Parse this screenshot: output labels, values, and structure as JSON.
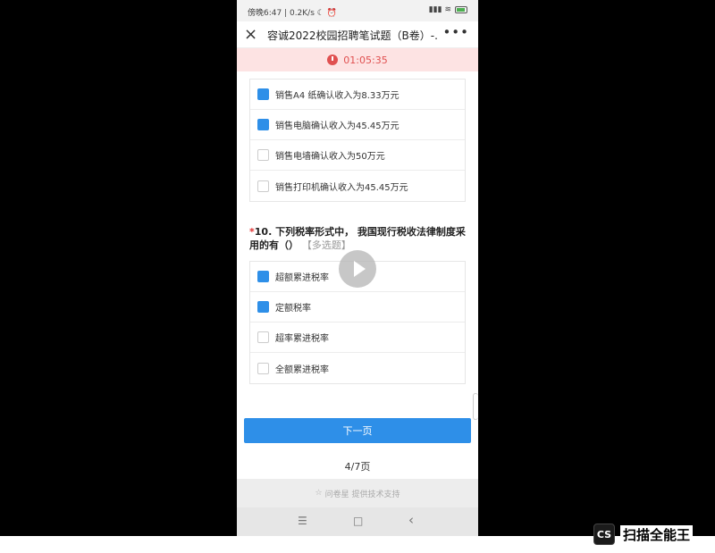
{
  "status_bar": {
    "left_text": "傍晚6:47 | 0.2K/s ☾ ⏰",
    "right_text": "▮▮▮ ≋"
  },
  "header": {
    "title": "容诚2022校园招聘笔试题（B卷）-...",
    "close_icon": "×",
    "more_icon": "•••"
  },
  "timer": {
    "value": "01:05:35",
    "icon": "timer-icon",
    "color": "#e05050"
  },
  "prev_question_options": [
    {
      "label": "销售A4 纸确认收入为8.33万元",
      "checked": true
    },
    {
      "label": "销售电脑确认收入为45.45万元",
      "checked": true
    },
    {
      "label": "销售电墙确认收入为50万元",
      "checked": false
    },
    {
      "label": "销售打印机确认收入为45.45万元",
      "checked": false
    }
  ],
  "question": {
    "required_mark": "*",
    "text": "10. 下列税率形式中， 我国现行税收法律制度采用的有（）",
    "type_tag": "【多选题】",
    "options": [
      {
        "label": "超额累进税率",
        "checked": true
      },
      {
        "label": "定额税率",
        "checked": true
      },
      {
        "label": "超率累进税率",
        "checked": false
      },
      {
        "label": "全额累进税率",
        "checked": false
      }
    ]
  },
  "next_button_label": "下一页",
  "page_counter": "4/7页",
  "footer_text": "问卷星 提供技术支持",
  "nav_bar": {
    "menu": "☰",
    "home": "□",
    "back": "‹"
  },
  "watermark": {
    "logo": "CS",
    "text": "扫描全能王"
  },
  "colors": {
    "accent": "#2e8fe8",
    "timer_bg": "#fde3e3"
  }
}
